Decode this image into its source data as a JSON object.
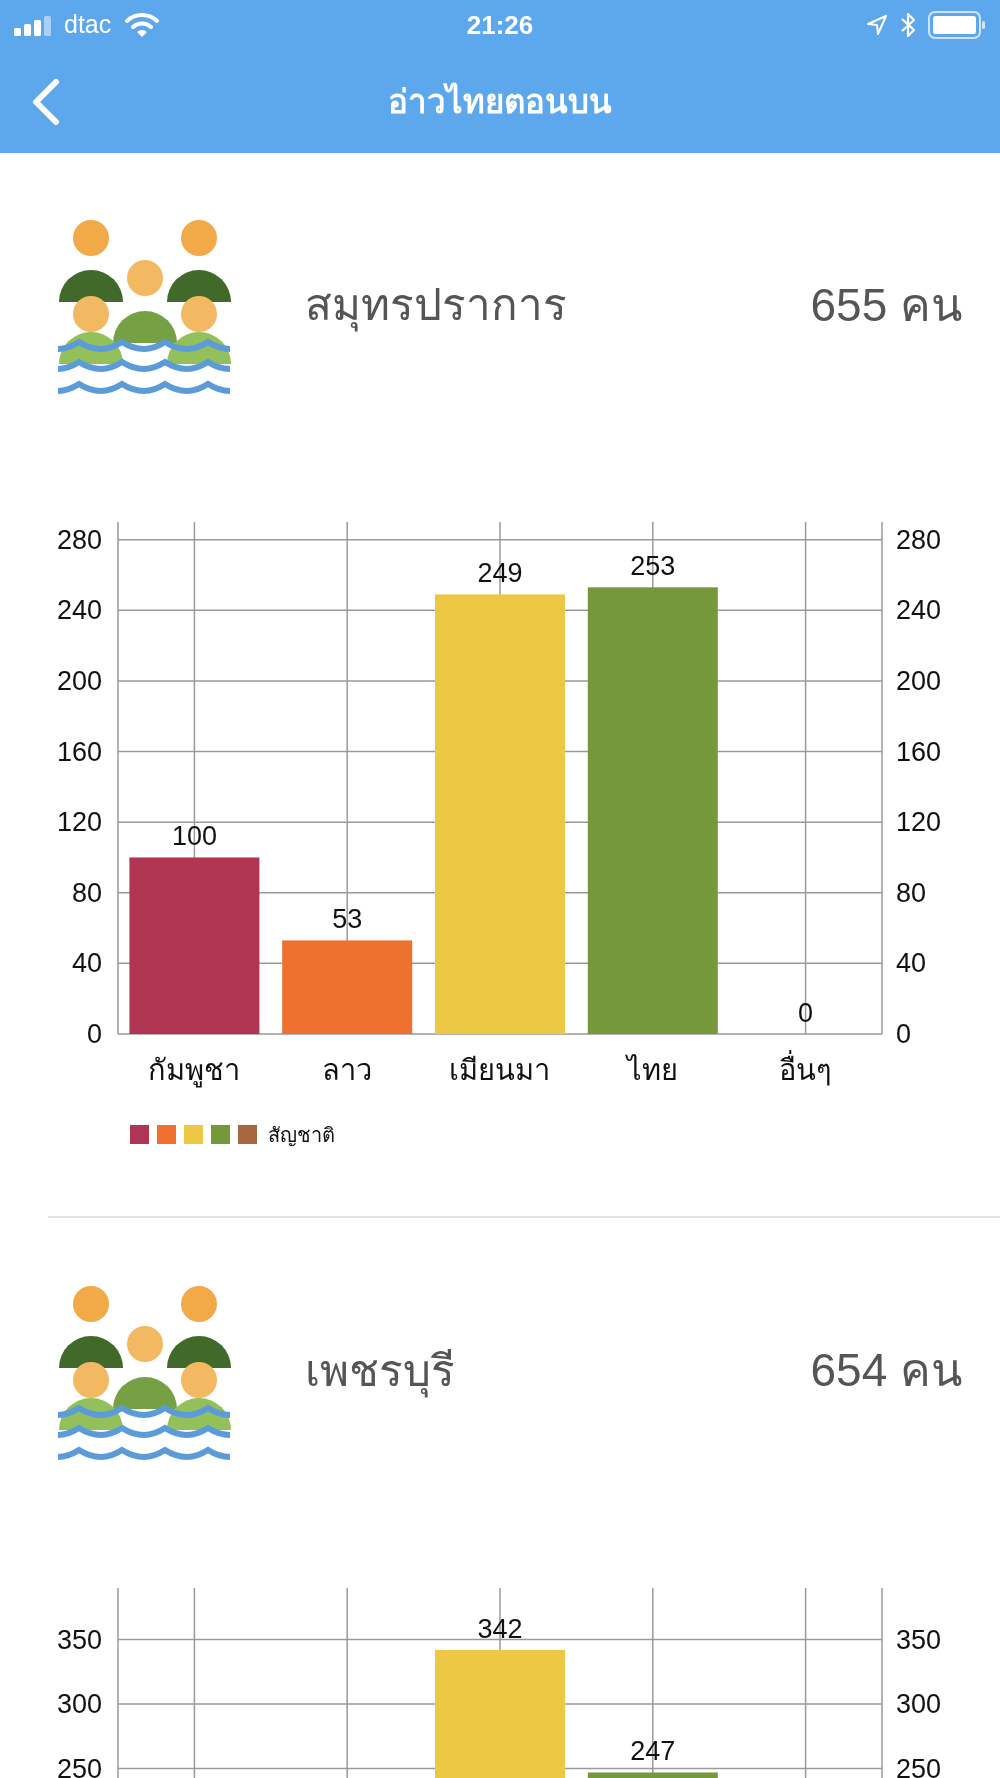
{
  "status_bar": {
    "carrier": "dtac",
    "time": "21:26"
  },
  "nav": {
    "title": "อ่าวไทยตอนบน"
  },
  "provinces": [
    {
      "name": "สมุทรปราการ",
      "count": "655 คน",
      "chart_data": {
        "type": "bar",
        "categories": [
          "กัมพูชา",
          "ลาว",
          "เมียนมา",
          "ไทย",
          "อื่นๆ"
        ],
        "series": [
          {
            "name": "สัญชาติ",
            "values": [
              100,
              53,
              249,
              253,
              0
            ]
          }
        ],
        "colors": [
          "#b03553",
          "#ee7130",
          "#ecc844",
          "#74983a",
          "#a6673e"
        ],
        "ylim": [
          0,
          290
        ],
        "yticks": [
          0,
          40,
          80,
          120,
          160,
          200,
          240,
          280
        ],
        "y2lim": [
          0,
          290
        ],
        "y2ticks": [
          0,
          40,
          80,
          120,
          160,
          200,
          240,
          280
        ],
        "grid": true,
        "data_labels": true
      }
    },
    {
      "name": "เพชรบุรี",
      "count": "654 คน",
      "chart_data": {
        "type": "bar",
        "values": [
          null,
          null,
          342,
          247,
          null
        ],
        "colors": [
          null,
          null,
          "#ecc844",
          "#74983a",
          null
        ],
        "ylim": [
          0,
          390
        ],
        "yticks": [
          250,
          300,
          350
        ],
        "y2lim": [
          0,
          390
        ],
        "y2ticks": [
          250,
          300,
          350
        ],
        "grid": true,
        "data_labels": true
      }
    }
  ]
}
